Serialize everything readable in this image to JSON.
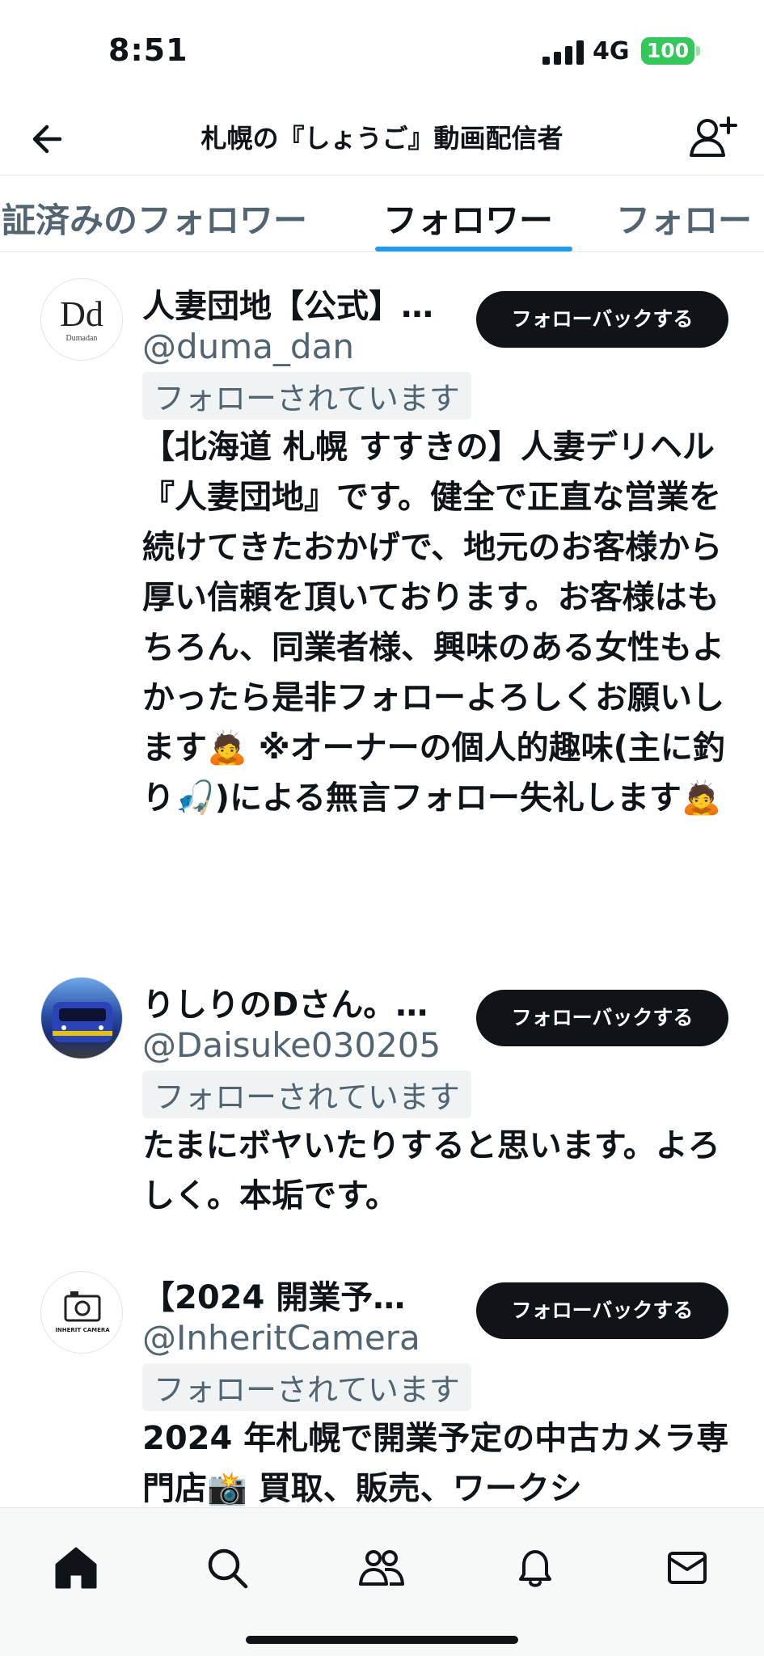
{
  "status_bar": {
    "time": "8:51",
    "network": "4G",
    "battery": "100"
  },
  "header": {
    "title": "札幌の『しょうご』動画配信者"
  },
  "tabs": [
    {
      "label": "証済みのフォロワー",
      "active": false
    },
    {
      "label": "フォロワー",
      "active": true
    },
    {
      "label": "フォロー",
      "active": false
    }
  ],
  "accounts": [
    {
      "name": "人妻団地【公式】…",
      "handle": "@duma_dan",
      "follows_you": "フォローされています",
      "follow_button": "フォローバックする",
      "avatar_logo": "Dd",
      "avatar_caption": "Dumadan",
      "bio": "【北海道 札幌 すすきの】人妻デリヘル『人妻団地』です。健全で正直な営業を続けてきたおかげで、地元のお客様から厚い信頼を頂いております。お客様はもちろん、同業者様、興味のある女性もよかったら是非フォローよろしくお願いします🙇 ※オーナーの個人的趣味(主に釣り🎣)による無言フォロー失礼します🙇"
    },
    {
      "name": "りしりのDさん。…",
      "handle": "@Daisuke030205",
      "follows_you": "フォローされています",
      "follow_button": "フォローバックする",
      "bio": "たまにボヤいたりすると思います。よろしく。本垢です。"
    },
    {
      "name": "【2024 開業予…",
      "handle": "@InheritCamera",
      "follows_you": "フォローされています",
      "follow_button": "フォローバックする",
      "avatar_logo": "INHERIT CAMERA",
      "bio": "2024 年札幌で開業予定の中古カメラ専門店📸 買取、販売、ワークシ"
    }
  ],
  "bottom_nav": [
    "home-icon",
    "search-icon",
    "communities-icon",
    "notifications-icon",
    "messages-icon"
  ],
  "colors": {
    "accent": "#1d9bf0",
    "text": "#0f1419",
    "secondary": "#536471",
    "battery": "#34c759"
  }
}
